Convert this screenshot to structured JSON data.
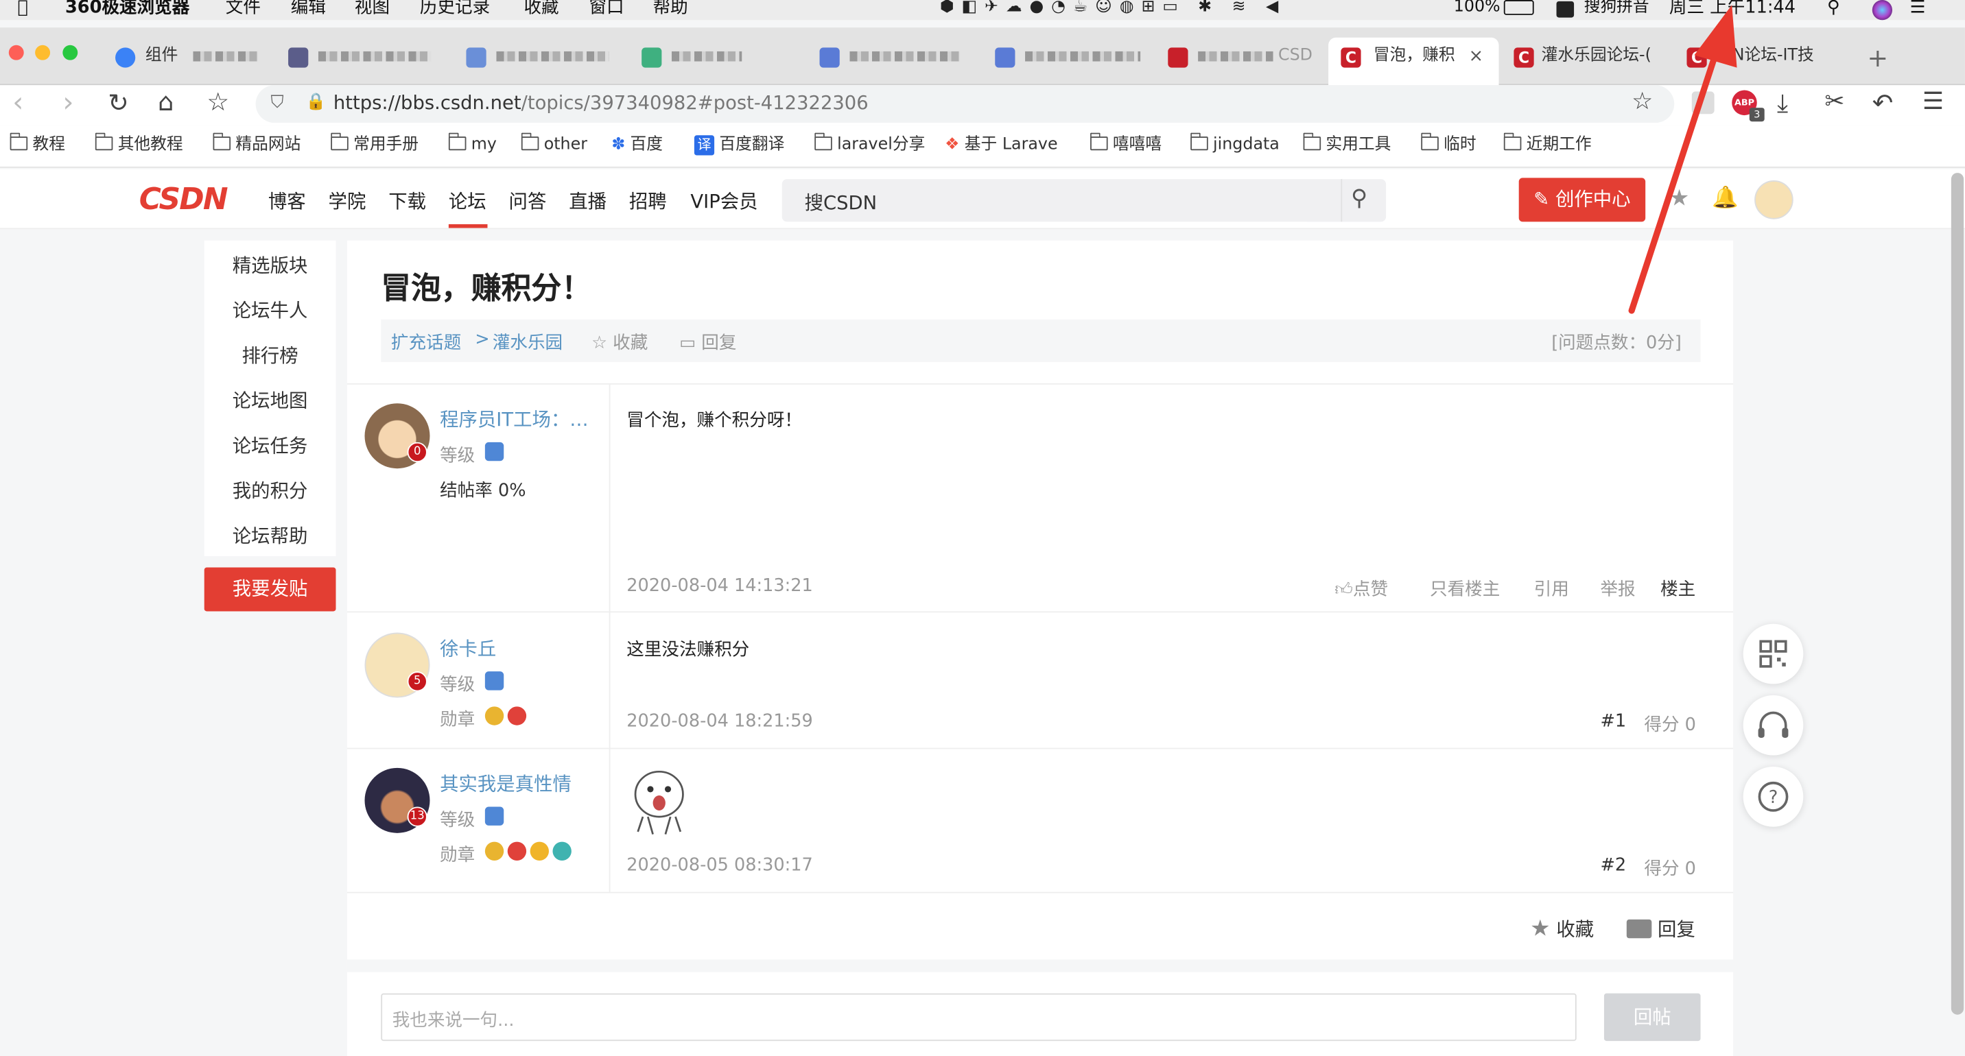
{
  "menubar": {
    "app": "360极速浏览器",
    "items": [
      "文件",
      "编辑",
      "视图",
      "历史记录",
      "收藏",
      "窗口",
      "帮助"
    ],
    "battery": "100%",
    "ime": "搜狗拼音",
    "clock": "周三 上午11:44"
  },
  "tabs": [
    {
      "label": "组件"
    },
    {
      "label": ""
    },
    {
      "label": ""
    },
    {
      "label": ""
    },
    {
      "label": ""
    },
    {
      "label": ""
    },
    {
      "label": "CSD"
    },
    {
      "label": "冒泡，赚积"
    },
    {
      "label": "灌水乐园论坛-("
    },
    {
      "label": "SDN论坛-IT技"
    }
  ],
  "address": {
    "url_host": "https://bbs.csdn.net",
    "url_path": "/topics/397340982#post-412322306",
    "abp_count": "3"
  },
  "bookmarks": [
    "教程",
    "其他教程",
    "精品网站",
    "常用手册",
    "my",
    "other",
    "百度",
    "百度翻译",
    "laravel分享",
    "基于 Larave",
    "嘻嘻嘻",
    "jingdata",
    "实用工具",
    "临时",
    "近期工作"
  ],
  "csdn": {
    "logo": "CSDN",
    "nav": [
      "博客",
      "学院",
      "下载",
      "论坛",
      "问答",
      "直播",
      "招聘",
      "VIP会员"
    ],
    "search_placeholder": "搜CSDN",
    "create_button": "创作中心"
  },
  "sidebar": {
    "items": [
      "精选版块",
      "论坛牛人",
      "排行榜",
      "论坛地图",
      "论坛任务",
      "我的积分",
      "论坛帮助"
    ],
    "post_button": "我要发贴"
  },
  "topic": {
    "title": "冒泡，赚积分！",
    "crumb_parent": "扩充话题",
    "crumb_sep": ">",
    "crumb_current": "灌水乐园",
    "favorite": "收藏",
    "reply": "回复",
    "points": "[问题点数：0分]"
  },
  "posts": [
    {
      "user": "程序员IT工场：…",
      "years": "0",
      "level_label": "等级",
      "extra": "结帖率 0%",
      "content": "冒个泡，赚个积分呀！",
      "time": "2020-08-04 14:13:21",
      "actions": [
        "点赞",
        "只看楼主",
        "引用",
        "举报",
        "楼主"
      ]
    },
    {
      "user": "徐卡丘",
      "years": "5",
      "level_label": "等级",
      "medal_label": "勋章",
      "content": "这里没法赚积分",
      "time": "2020-08-04 18:21:59",
      "floor": "#1",
      "score": "得分 0"
    },
    {
      "user": "其实我是真性情",
      "years": "13",
      "level_label": "等级",
      "medal_label": "勋章",
      "content": "",
      "time": "2020-08-05 08:30:17",
      "floor": "#2",
      "score": "得分 0"
    }
  ],
  "footer": {
    "favorite": "收藏",
    "reply": "回复",
    "input_placeholder": "我也来说一句...",
    "submit": "回帖"
  },
  "colors": {
    "brand_red": "#e33e33",
    "link_blue": "#5893c2",
    "arrow_red": "#e8392e"
  }
}
